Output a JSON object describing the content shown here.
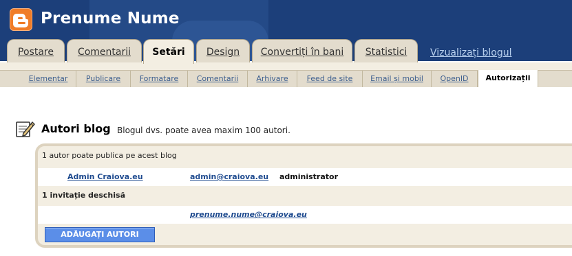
{
  "header": {
    "blog_title": "Prenume Nume",
    "logo_icon": "blogger-logo"
  },
  "tabs": [
    {
      "label": "Postare",
      "active": false
    },
    {
      "label": "Comentarii",
      "active": false
    },
    {
      "label": "Setări",
      "active": true
    },
    {
      "label": "Design",
      "active": false
    },
    {
      "label": "Convertiți în bani",
      "active": false
    },
    {
      "label": "Statistici",
      "active": false
    }
  ],
  "view_blog_link": "Vizualizați blogul",
  "subnav": [
    {
      "label": "Elementar",
      "active": false
    },
    {
      "label": "Publicare",
      "active": false
    },
    {
      "label": "Formatare",
      "active": false
    },
    {
      "label": "Comentarii",
      "active": false
    },
    {
      "label": "Arhivare",
      "active": false
    },
    {
      "label": "Feed de site",
      "active": false
    },
    {
      "label": "Email și mobil",
      "active": false
    },
    {
      "label": "OpenID",
      "active": false
    },
    {
      "label": "Autorizații",
      "active": true
    }
  ],
  "section": {
    "icon": "edit-notepad-icon",
    "title": "Autori blog",
    "description": "Blogul dvs. poate avea maxim 100 autori."
  },
  "authors": {
    "count_text": "1 autor poate publica pe acest blog",
    "list": [
      {
        "name": "Admin Craiova.eu",
        "email": "admin@craiova.eu",
        "role": "administrator"
      }
    ]
  },
  "invitations": {
    "count_text": "1 invitație deschisă",
    "list": [
      {
        "email": "prenume.nume@craiova.eu"
      }
    ]
  },
  "add_button_label": "ADĂUGAȚI AUTORI",
  "colors": {
    "header_bg": "#1c3f7a",
    "logo": "#f07d28",
    "tab_bg": "#e3dccd",
    "link": "#1f4b8f",
    "button": "#5b8ee8"
  }
}
